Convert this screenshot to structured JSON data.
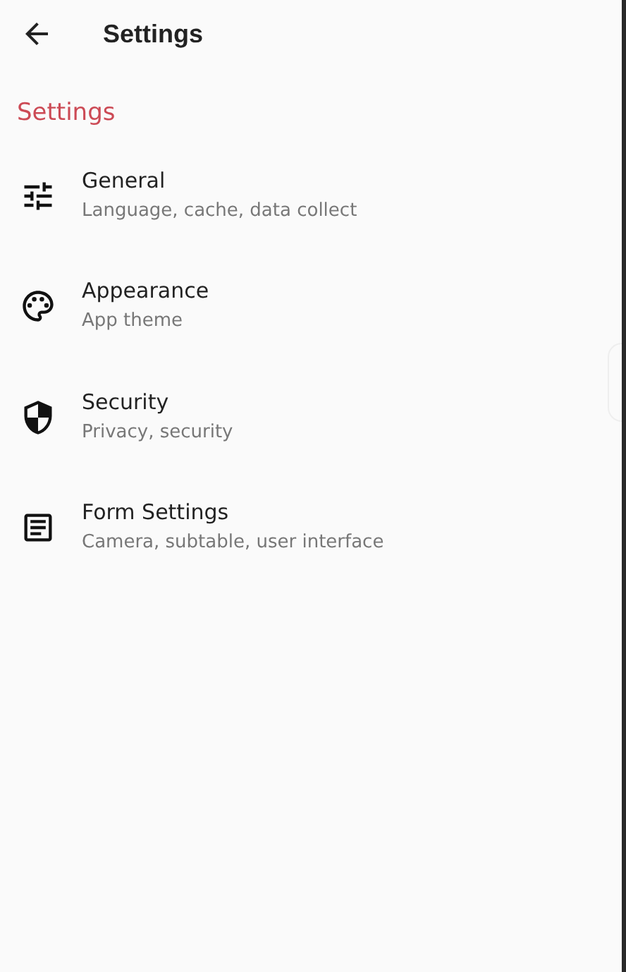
{
  "header": {
    "title": "Settings"
  },
  "section": {
    "title": "Settings"
  },
  "items": [
    {
      "title": "General",
      "subtitle": "Language, cache, data collect"
    },
    {
      "title": "Appearance",
      "subtitle": "App theme"
    },
    {
      "title": "Security",
      "subtitle": "Privacy, security"
    },
    {
      "title": "Form Settings",
      "subtitle": "Camera, subtable, user interface"
    }
  ]
}
